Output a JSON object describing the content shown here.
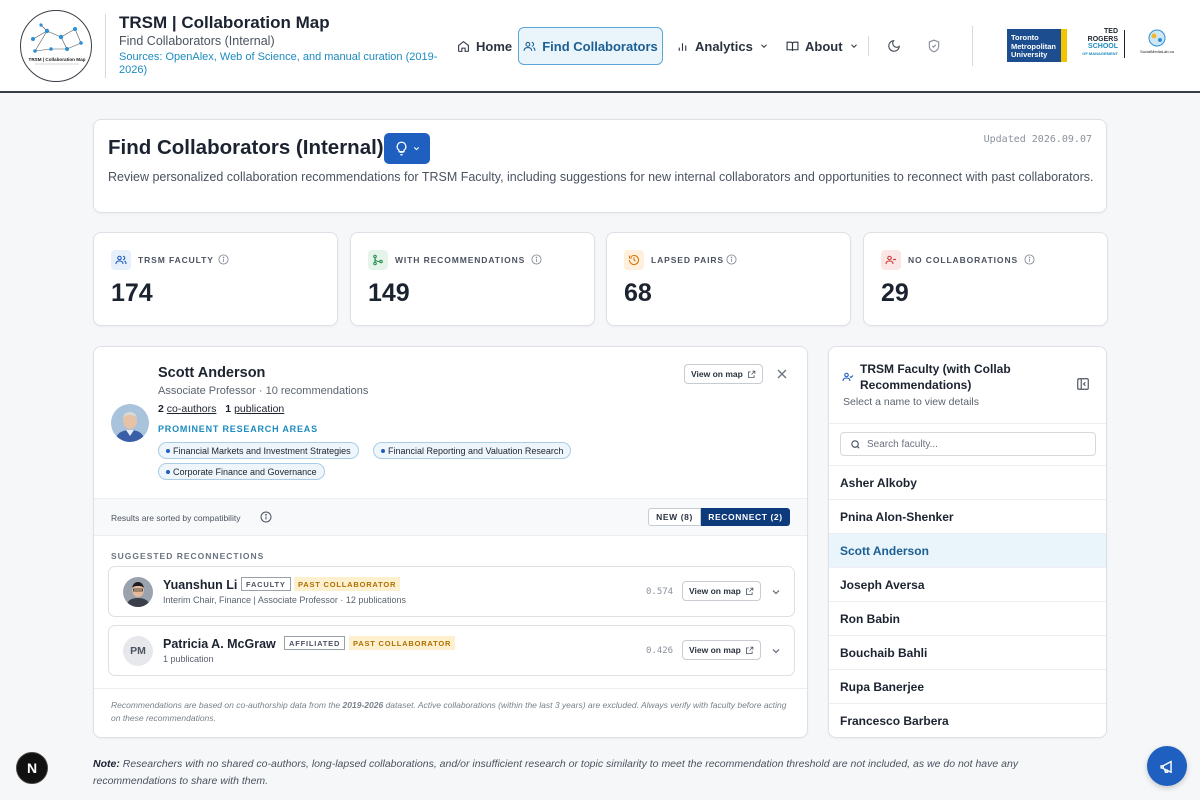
{
  "header": {
    "logo_text": "TRSM | Collaboration Map",
    "title": "TRSM | Collaboration Map",
    "subtitle": "Find Collaborators (Internal)",
    "sources": "Sources: OpenAlex, Web of Science, and manual curation (2019-2026)",
    "nav": {
      "home": "Home",
      "find": "Find Collaborators",
      "analytics": "Analytics",
      "about": "About"
    },
    "partner_logos": {
      "tmu": [
        "Toronto",
        "Metropolitan",
        "University"
      ],
      "ted": [
        "TED",
        "ROGERS",
        "SCHOOL",
        "OF MANAGEMENT"
      ],
      "sml": "SocialMediaLab.ca"
    },
    "accent": "#1f5fbf"
  },
  "hero": {
    "title": "Find Collaborators (Internal)",
    "updated": "Updated 2026.09.07",
    "description": "Review personalized collaboration recommendations for TRSM Faculty, including suggestions for new internal collaborators and opportunities to reconnect with past collaborators."
  },
  "stats": [
    {
      "label": "TRSM FACULTY",
      "value": "174",
      "icon": "users-icon",
      "color": "#1f5fbf"
    },
    {
      "label": "WITH RECOMMENDATIONS",
      "value": "149",
      "icon": "git-branch-icon",
      "color": "#1f8f4a"
    },
    {
      "label": "LAPSED PAIRS",
      "value": "68",
      "icon": "history-icon",
      "color": "#d97706"
    },
    {
      "label": "NO COLLABORATIONS",
      "value": "29",
      "icon": "user-minus-icon",
      "color": "#d13b3b"
    }
  ],
  "profile": {
    "name": "Scott Anderson",
    "role": "Associate Professor · 10 recommendations",
    "coauthors_count": "2",
    "coauthors_label": "co-authors",
    "pubs_count": "1",
    "pubs_label": "publication",
    "areas_title": "PROMINENT RESEARCH AREAS",
    "areas": [
      "Financial Markets and Investment Strategies",
      "Financial Reporting and Valuation Research",
      "Corporate Finance and Governance"
    ],
    "view_map": "View on map"
  },
  "sortbar": {
    "text": "Results are sorted by compatibility",
    "new_label": "NEW (8)",
    "reconnect_label": "RECONNECT (2)"
  },
  "suggestions": {
    "title": "SUGGESTED RECONNECTIONS",
    "items": [
      {
        "name": "Yuanshun Li",
        "tag": "FACULTY",
        "status": "PAST COLLABORATOR",
        "sub": "Interim Chair, Finance | Associate Professor · 12 publications",
        "score": "0.574",
        "view_map": "View on map"
      },
      {
        "name": "Patricia A. McGraw",
        "initials": "PM",
        "tag": "AFFILIATED",
        "status": "PAST COLLABORATOR",
        "sub": "1 publication",
        "score": "0.426",
        "view_map": "View on map"
      }
    ]
  },
  "disclaimer": {
    "pre": "Recommendations are based on co-authorship data from the ",
    "dataset": "2019-2026",
    "post": " dataset. Active collaborations (within the last 3 years) are excluded. Always verify with faculty before acting on these recommendations."
  },
  "faculty_list": {
    "title": "TRSM Faculty (with Collab Recommendations)",
    "subtitle": "Select a name to view details",
    "search_placeholder": "Search faculty...",
    "items": [
      "Asher Alkoby",
      "Pnina Alon-Shenker",
      "Scott Anderson",
      "Joseph Aversa",
      "Ron Babin",
      "Bouchaib Bahli",
      "Rupa Banerjee",
      "Francesco Barbera"
    ],
    "selected": "Scott Anderson"
  },
  "note": {
    "label": "Note:",
    "text": " Researchers with no shared co-authors, long-lapsed collaborations, and/or insufficient research or topic similarity to meet the recommendation threshold are not included, as we do not have any recommendations to share with them."
  },
  "corner_badge": "N"
}
